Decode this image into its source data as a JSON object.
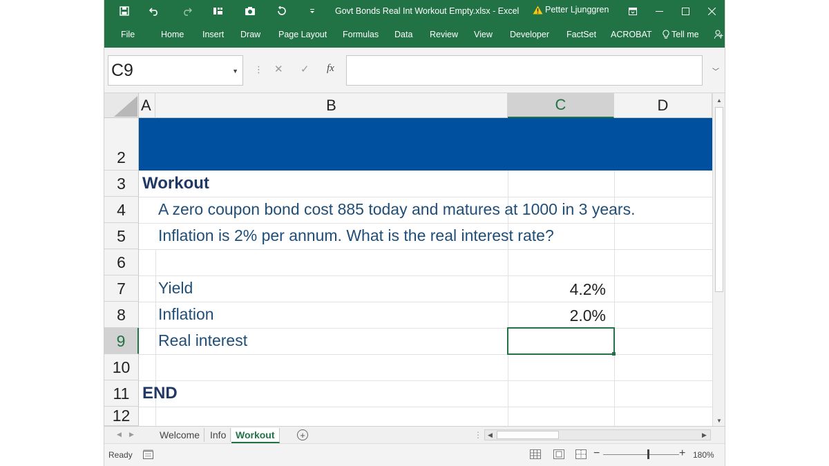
{
  "titlebar": {
    "title": "Govt Bonds Real Int Workout Empty.xlsx  -  Excel",
    "user": "Petter Ljunggren",
    "icons": [
      "save-icon",
      "undo-icon",
      "redo-icon",
      "quick-access-icon",
      "camera-icon",
      "refresh-icon",
      "customize-icon"
    ],
    "window_controls": [
      "ribbon-display-icon",
      "minimize-icon",
      "maximize-icon",
      "close-icon"
    ]
  },
  "ribbon": {
    "tabs": [
      "File",
      "Home",
      "Insert",
      "Draw",
      "Page Layout",
      "Formulas",
      "Data",
      "Review",
      "View",
      "Developer",
      "FactSet",
      "ACROBAT"
    ],
    "tell_me": "Tell me"
  },
  "formula_bar": {
    "name_box": "C9",
    "fx": "fx",
    "formula": ""
  },
  "grid": {
    "columns": [
      "A",
      "B",
      "C",
      "D"
    ],
    "rows": [
      "2",
      "3",
      "4",
      "5",
      "6",
      "7",
      "8",
      "9",
      "10",
      "11",
      "12"
    ],
    "band_color": "#0050a0",
    "cells": {
      "workout_heading": "Workout",
      "question_line1": "A zero coupon bond cost 885 today and matures at 1000 in 3 years.",
      "question_line2": "Inflation is 2% per annum. What is the real interest rate?",
      "yield_label": "Yield",
      "yield_value": "4.2%",
      "inflation_label": "Inflation",
      "inflation_value": "2.0%",
      "real_interest_label": "Real interest",
      "end_label": "END"
    },
    "selected_cell": "C9"
  },
  "sheet_tabs": {
    "tabs": [
      "Welcome",
      "Info",
      "Workout"
    ],
    "active": "Workout"
  },
  "status_bar": {
    "status": "Ready",
    "zoom": "180%",
    "accent": "#217346"
  }
}
